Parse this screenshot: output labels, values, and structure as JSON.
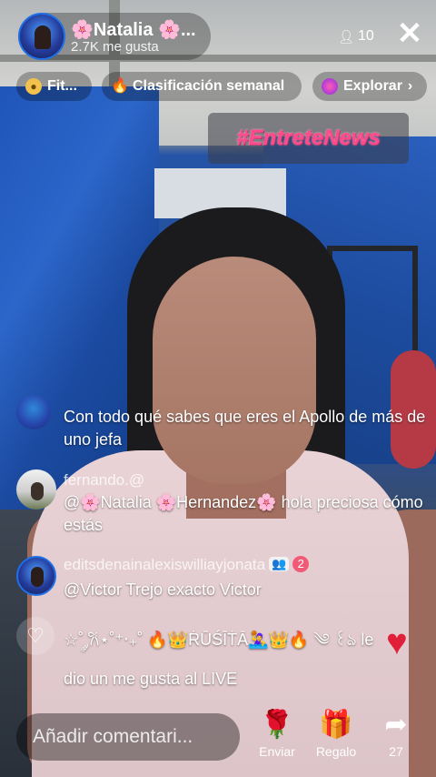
{
  "host": {
    "name": "🌸Natalia 🌸...",
    "likes": "2.7K me gusta"
  },
  "viewers": {
    "count": "10",
    "icon": "person-icon"
  },
  "chips": [
    {
      "label": "Fit...",
      "icon": "fitness-badge-icon"
    },
    {
      "label": "Clasificación semanal",
      "icon": "flame-icon"
    },
    {
      "label": "Explorar",
      "icon": "explore-orb-icon"
    }
  ],
  "hashtag": "#EntreteNews",
  "chat": [
    {
      "user": "",
      "message": "Con todo qué sabes que eres el Apollo de más de uno jefa"
    },
    {
      "user": "fernando.@",
      "message": "@🌸Natalia 🌸Hernandez🌸 hola preciosa cómo estás"
    },
    {
      "user": "editsdenainalexiswilliayjonata",
      "message": "@Victor Trejo exacto Victor"
    },
    {
      "user": "",
      "message": "☆˚ ༘𐙚⋆˚⁺‧₊˚ 🔥👑ṘŪŚĪṪĀ🤽‍♀️👑🔥 ༄ ꒰ঌ le dio un me gusta al LIVE"
    }
  ],
  "badges": {
    "user_badge": "👥",
    "level_badge": "2"
  },
  "comment_placeholder": "Añadir comentari...",
  "actions": {
    "send_label": "Enviar",
    "gift_label": "Regalo",
    "share_count": "27"
  },
  "colors": {
    "hashtag": "#ff4a8a",
    "heart": "#e02038",
    "avatar_ring": "#1f6fe6"
  }
}
